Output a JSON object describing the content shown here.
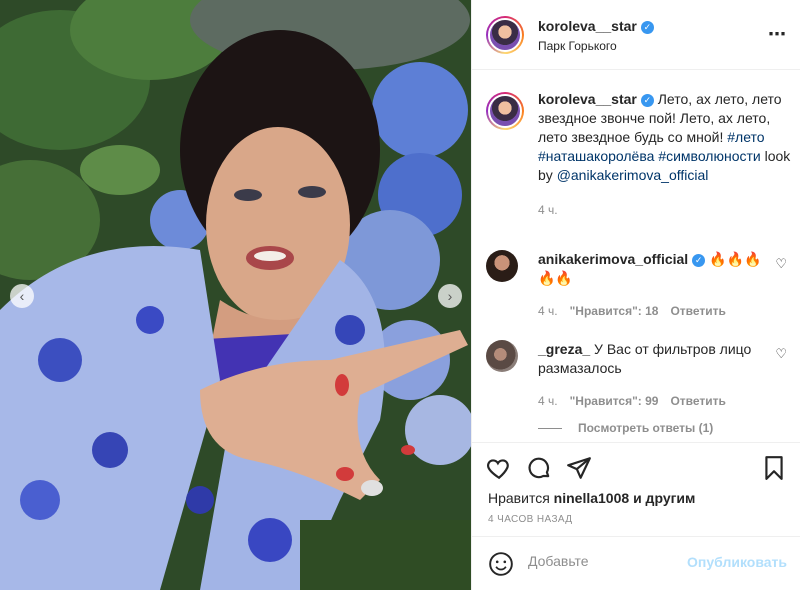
{
  "header": {
    "username": "koroleva__star",
    "location": "Парк Горького",
    "more_icon": "⋯"
  },
  "caption": {
    "username": "koroleva__star",
    "text_1": "Лето, ах лето, лето звездное звонче пой! Лето, ах лето, лето звездное будь со мной!",
    "tag_1": "#лето",
    "tag_2": "#наташакоролёва",
    "tag_3": "#символюности",
    "text_2": "look by",
    "mention": "@anikakerimova_official",
    "time": "4 ч."
  },
  "comments": [
    {
      "username": "anikakerimova_official",
      "text": "🔥🔥🔥🔥🔥",
      "time": "4 ч.",
      "likes": "\"Нравится\": 18",
      "reply": "Ответить"
    },
    {
      "username": "_greza_",
      "text": "У Вас от фильтров лицо размазалось",
      "time": "4 ч.",
      "likes": "\"Нравится\": 99",
      "reply": "Ответить"
    }
  ],
  "view_replies": "Посмотреть ответы (1)",
  "likes_line": {
    "prefix": "Нравится",
    "user": "ninella1008",
    "suffix": "и другим"
  },
  "post_time": "4 ЧАСОВ НАЗАД",
  "add_comment": {
    "placeholder": "Добавьте комментарий...",
    "placeholder_visible": "Добавьте",
    "publish": "Опубликовать"
  },
  "colors": {
    "verified": "#3897f0",
    "publish_disabled": "#b2dffc",
    "hashtag": "#003569",
    "secondary_text": "#8e8e8e"
  },
  "icons": [
    "heart-icon",
    "comment-icon",
    "share-icon",
    "bookmark-icon",
    "emoji-icon",
    "verified-icon",
    "more-icon"
  ]
}
